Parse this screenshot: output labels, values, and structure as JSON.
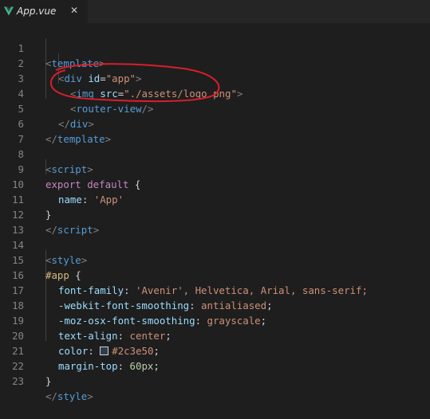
{
  "tab": {
    "title": "App.vue",
    "close": "✕",
    "icon": "vue-logo-icon"
  },
  "colors": {
    "accent_vue": "#41b883",
    "annotation": "#d81e2a",
    "swatch": "#2c3e50"
  },
  "lines": [
    {
      "n": "1"
    },
    {
      "n": "2"
    },
    {
      "n": "3"
    },
    {
      "n": "4"
    },
    {
      "n": "5"
    },
    {
      "n": "6"
    },
    {
      "n": "7"
    },
    {
      "n": "8"
    },
    {
      "n": "9"
    },
    {
      "n": "10"
    },
    {
      "n": "11"
    },
    {
      "n": "12"
    },
    {
      "n": "13"
    },
    {
      "n": "14"
    },
    {
      "n": "15"
    },
    {
      "n": "16"
    },
    {
      "n": "17"
    },
    {
      "n": "18"
    },
    {
      "n": "19"
    },
    {
      "n": "20"
    },
    {
      "n": "21"
    },
    {
      "n": "22"
    },
    {
      "n": "23"
    }
  ],
  "code": {
    "l1": {
      "open": "<",
      "tag": "template",
      "close": ">"
    },
    "l2": {
      "open": "<",
      "tag": "div",
      "attr": " id",
      "eq": "=",
      "val": "\"app\"",
      "close": ">"
    },
    "l3": {
      "open": "<",
      "tag": "img",
      "attr": " src",
      "eq": "=",
      "val": "\"./assets/logo.png\"",
      "close": ">"
    },
    "l4": {
      "open": "<",
      "tag": "router-view",
      "close": "/>"
    },
    "l5": {
      "open": "</",
      "tag": "div",
      "close": ">"
    },
    "l6": {
      "open": "</",
      "tag": "template",
      "close": ">"
    },
    "l8": {
      "open": "<",
      "tag": "script",
      "close": ">"
    },
    "l9": {
      "kw1": "export",
      "kw2": " default",
      "punc": " {"
    },
    "l10": {
      "prop": "name",
      "punc": ": ",
      "val": "'App'"
    },
    "l11": {
      "punc": "}"
    },
    "l12": {
      "open": "</",
      "tag": "script",
      "close": ">"
    },
    "l14": {
      "open": "<",
      "tag": "style",
      "close": ">"
    },
    "l15": {
      "sel": "#app",
      "punc": " {"
    },
    "l16": {
      "prop": "font-family",
      "punc": ": ",
      "val": "'Avenir'",
      "rest": ", Helvetica, Arial, sans-serif;"
    },
    "l17": {
      "prop": "-webkit-font-smoothing",
      "punc": ": ",
      "val": "antialiased",
      "end": ";"
    },
    "l18": {
      "prop": "-moz-osx-font-smoothing",
      "punc": ": ",
      "val": "grayscale",
      "end": ";"
    },
    "l19": {
      "prop": "text-align",
      "punc": ": ",
      "val": "center",
      "end": ";"
    },
    "l20": {
      "prop": "color",
      "punc": ": ",
      "val": "#2c3e50",
      "end": ";"
    },
    "l21": {
      "prop": "margin-top",
      "punc": ": ",
      "val": "60px",
      "end": ";"
    },
    "l22": {
      "punc": "}"
    },
    "l23": {
      "open": "</",
      "tag": "style",
      "close": ">"
    }
  }
}
